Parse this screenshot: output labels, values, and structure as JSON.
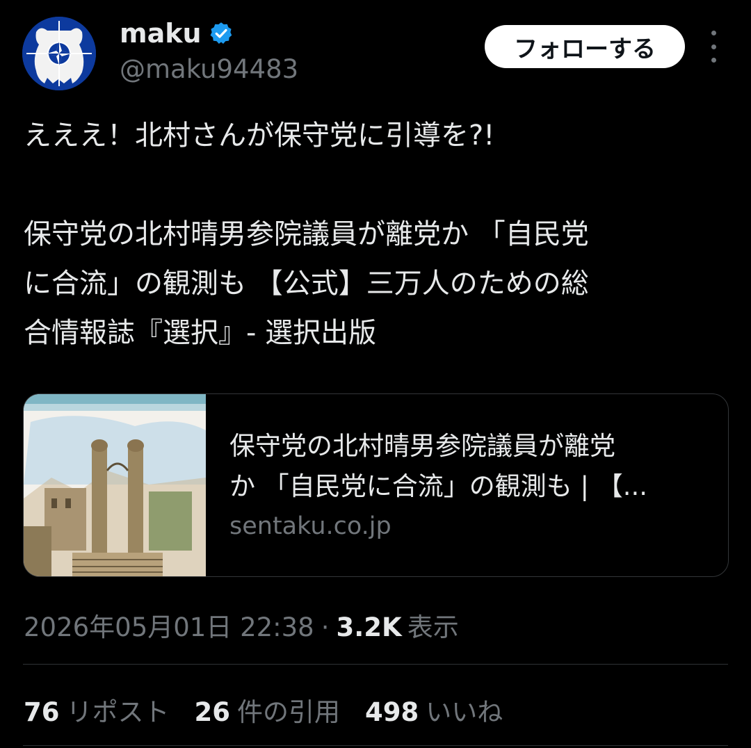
{
  "author": {
    "display_name": "maku",
    "handle": "@maku94483",
    "avatar_icon": "bear-nato-star-avatar",
    "verified_icon": "verified-badge-icon",
    "verified_color": "#1d9bf0"
  },
  "actions": {
    "follow_label": "フォローする",
    "more_icon": "more-vertical-icon"
  },
  "tweet": {
    "line1": "えええ！北村さんが保守党に引導を?!",
    "para2_line1": "保守党の北村晴男参院議員が離党か 「自民党",
    "para2_line2": "に合流」の観測も 【公式】三万人のための総",
    "para2_line3": "合情報誌『選択』- 選択出版"
  },
  "link_card": {
    "title_line1": "保守党の北村晴男参院議員が離党",
    "title_line2": "か 「自民党に合流」の観測も | 【...",
    "domain": "sentaku.co.jp"
  },
  "meta": {
    "timestamp": "2026年05月01日 22:38",
    "separator": "·",
    "views_count": "3.2K",
    "views_label": "表示"
  },
  "stats": {
    "reposts_count": "76",
    "reposts_label": "リポスト",
    "quotes_count": "26",
    "quotes_label": "件の引用",
    "likes_count": "498",
    "likes_label": "いいね"
  },
  "colors": {
    "background": "#000000",
    "text_primary": "#e7e9ea",
    "text_secondary": "#71767b",
    "border": "#2f3336"
  }
}
